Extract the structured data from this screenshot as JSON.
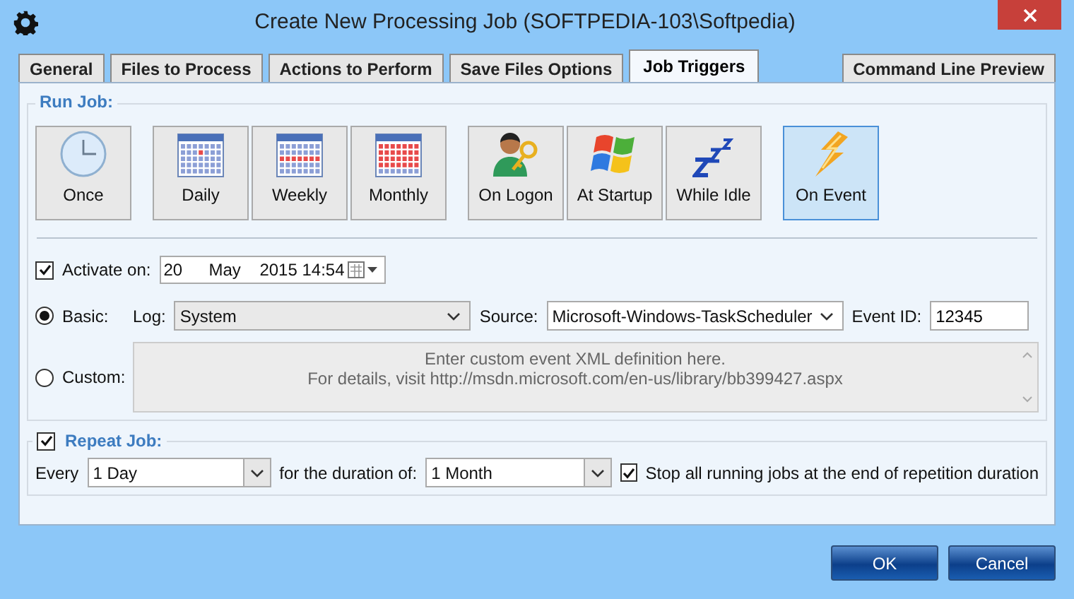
{
  "window": {
    "title": "Create New Processing Job (SOFTPEDIA-103\\Softpedia)"
  },
  "tabs": [
    {
      "label": "General",
      "selected": false
    },
    {
      "label": "Files to Process",
      "selected": false
    },
    {
      "label": "Actions to Perform",
      "selected": false
    },
    {
      "label": "Save Files Options",
      "selected": false
    },
    {
      "label": "Job Triggers",
      "selected": true
    },
    {
      "label": "Command Line Preview",
      "selected": false,
      "kind": "right"
    }
  ],
  "run_job": {
    "label": "Run Job:",
    "trigger_groups": [
      [
        {
          "label": "Once",
          "kind": "clock",
          "selected": false
        }
      ],
      [
        {
          "label": "Daily",
          "kind": "daily",
          "selected": false
        },
        {
          "label": "Weekly",
          "kind": "weekly",
          "selected": false
        },
        {
          "label": "Monthly",
          "kind": "monthly",
          "selected": false
        }
      ],
      [
        {
          "label": "On Logon",
          "kind": "logon",
          "selected": false
        },
        {
          "label": "At Startup",
          "kind": "startup",
          "selected": false
        },
        {
          "label": "While Idle",
          "kind": "idle",
          "selected": false
        }
      ],
      [
        {
          "label": "On Event",
          "kind": "event",
          "selected": true
        }
      ]
    ]
  },
  "activate": {
    "label": "Activate on:",
    "checked": true,
    "date_parts": [
      "20",
      "May",
      "2015 14:54"
    ]
  },
  "basic": {
    "label": "Basic:",
    "selected": true,
    "log_label": "Log:",
    "log_value": "System",
    "source_label": "Source:",
    "source_value": "Microsoft-Windows-TaskScheduler",
    "event_id_label": "Event ID:",
    "event_id_value": "12345"
  },
  "custom": {
    "label": "Custom:",
    "selected": false,
    "placeholder": "Enter custom event XML definition here.\nFor details, visit http://msdn.microsoft.com/en-us/library/bb399427.aspx"
  },
  "repeat": {
    "label": "Repeat Job:",
    "checked": true,
    "every_label": "Every",
    "every_value": "1 Day",
    "duration_label": "for the duration of:",
    "duration_value": "1 Month",
    "stop_label": "Stop all running jobs at the end of repetition duration",
    "stop_checked": true
  },
  "buttons": [
    "OK",
    "Cancel"
  ]
}
